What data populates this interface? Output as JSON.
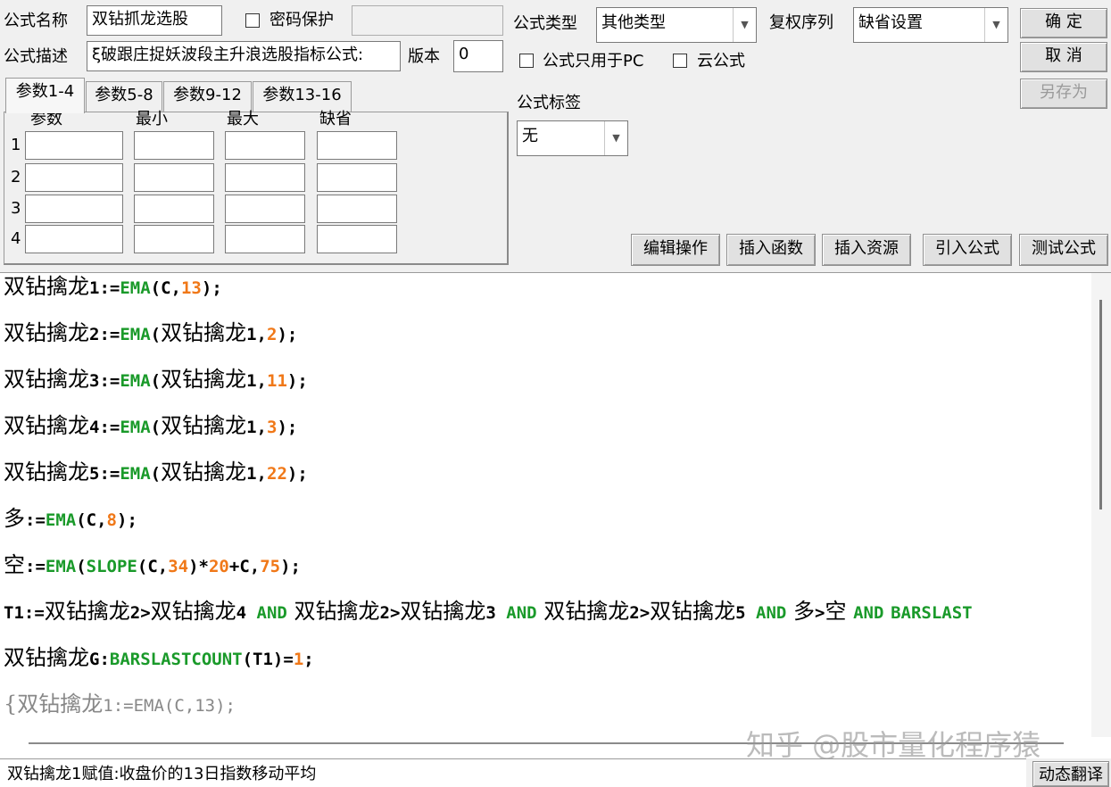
{
  "header": {
    "name_label": "公式名称",
    "name_value": "双钻抓龙选股",
    "password_label": "密码保护",
    "password_value": "",
    "desc_label": "公式描述",
    "desc_value": "ξ破跟庄捉妖波段主升浪选股指标公式:",
    "version_label": "版本",
    "version_value": "0",
    "type_label": "公式类型",
    "type_value": "其他类型",
    "rights_label": "复权序列",
    "rights_value": "缺省设置",
    "pc_only_label": "公式只用于PC",
    "cloud_label": "云公式",
    "tag_label": "公式标签",
    "tag_value": "无"
  },
  "buttons": {
    "ok": "确 定",
    "cancel": "取 消",
    "save_as": "另存为",
    "edit_ops": "编辑操作",
    "insert_func": "插入函数",
    "insert_res": "插入资源",
    "import_formula": "引入公式",
    "test_formula": "测试公式",
    "dynamic_translate": "动态翻译"
  },
  "params": {
    "tabs": [
      "参数1-4",
      "参数5-8",
      "参数9-12",
      "参数13-16"
    ],
    "columns": [
      "参数",
      "最小",
      "最大",
      "缺省"
    ],
    "rows": [
      "1",
      "2",
      "3",
      "4"
    ]
  },
  "code": {
    "l1": {
      "a": "双钻擒龙",
      "b": "1:=",
      "c": "EMA",
      "d": "(C,",
      "e": "13",
      "f": ");"
    },
    "l2": {
      "a": "双钻擒龙",
      "b": "2:=",
      "c": "EMA",
      "d": "(",
      "d2": "双钻擒龙",
      "d3": "1,",
      "e": "2",
      "f": ");"
    },
    "l3": {
      "a": "双钻擒龙",
      "b": "3:=",
      "c": "EMA",
      "d": "(",
      "d2": "双钻擒龙",
      "d3": "1,",
      "e": "11",
      "f": ");"
    },
    "l4": {
      "a": "双钻擒龙",
      "b": "4:=",
      "c": "EMA",
      "d": "(",
      "d2": "双钻擒龙",
      "d3": "1,",
      "e": "3",
      "f": ");"
    },
    "l5": {
      "a": "双钻擒龙",
      "b": "5:=",
      "c": "EMA",
      "d": "(",
      "d2": "双钻擒龙",
      "d3": "1,",
      "e": "22",
      "f": ");"
    },
    "l6": {
      "a": "多",
      "b": ":=",
      "c": "EMA",
      "d": "(C,",
      "e": "8",
      "f": ");"
    },
    "l7": {
      "a": "空",
      "b": ":=",
      "c": "EMA",
      "d": "(",
      "c2": "SLOPE",
      "d2": "(C,",
      "e": "34",
      "f": ")*",
      "e2": "20",
      "f2": "+C,",
      "e3": "75",
      "f3": ");"
    },
    "l8": {
      "a": "T1:=",
      "b": "双钻擒龙",
      "c": "2>",
      "d": "双钻擒龙",
      "e": "4 ",
      "and": "AND",
      "g": "双钻擒龙",
      "h": "2>",
      "i": "双钻擒龙",
      "j": "3 ",
      "and2": "AND",
      "k": "双钻擒龙",
      "l": "2>",
      "m": "双钻擒龙",
      "n": "5 ",
      "and3": "AND",
      "p": "多",
      "q": ">",
      "r": "空",
      "and4": "AND",
      "s": "BARSLAST"
    },
    "l9": {
      "a": "双钻擒龙",
      "b": "G:",
      "c": "BARSLASTCOUNT",
      "d": "(T1)=",
      "e": "1",
      "f": ";"
    },
    "l10": {
      "a": "{",
      "b": "双钻擒龙",
      "c": "1:=EMA(C,13);"
    }
  },
  "status": {
    "text": "双钻擒龙1赋值:收盘价的13日指数移动平均"
  },
  "watermark": "知乎 @股市量化程序猿"
}
